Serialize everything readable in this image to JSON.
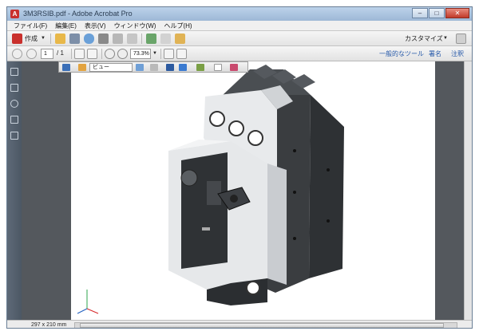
{
  "window": {
    "title": "3M3RSIB.pdf - Adobe Acrobat Pro"
  },
  "menu": {
    "items": [
      "ファイル(F)",
      "編集(E)",
      "表示(V)",
      "ウィンドウ(W)",
      "ヘルプ(H)"
    ]
  },
  "toolbar1": {
    "create_label": "作成",
    "customize_label": "カスタマイズ"
  },
  "toolbar2": {
    "page_current": "1",
    "page_total": "/ 1",
    "zoom": "73.3%",
    "tools_label": "一般的なツール",
    "sign_label": "署名",
    "comment_label": "注釈"
  },
  "toolbar3d": {
    "view_label": "ビュー"
  },
  "status": {
    "page_size": "297 x 210 mm"
  },
  "colors": {
    "housing_dark": "#3a3d40",
    "housing_light": "#e8eaec",
    "doc_background": "#54585d"
  }
}
